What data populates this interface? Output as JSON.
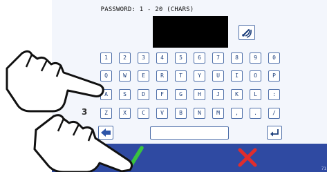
{
  "header": {
    "title": "PASSWORD: 1 - 20 (CHARS)"
  },
  "password_display": {
    "value": ""
  },
  "keyboard": {
    "rows": [
      [
        "1",
        "2",
        "3",
        "4",
        "5",
        "6",
        "7",
        "8",
        "9",
        "0"
      ],
      [
        "Q",
        "W",
        "E",
        "R",
        "T",
        "Y",
        "U",
        "I",
        "O",
        "P"
      ],
      [
        "A",
        "S",
        "D",
        "F",
        "G",
        "H",
        "J",
        "K",
        "L",
        ":"
      ],
      [
        "Z",
        "X",
        "C",
        "V",
        "B",
        "N",
        "M",
        ",",
        ".",
        "/"
      ]
    ]
  },
  "annotations": {
    "step_number": "3"
  },
  "footer": {
    "page_number": "71"
  },
  "colors": {
    "key_border": "#4d6ea8",
    "key_text": "#1d3f7c",
    "footer_bar": "#2f4aa2",
    "confirm": "#39c33f",
    "cancel": "#e02d2d"
  },
  "icons": {
    "nfc": "nfc-icon",
    "backspace": "backspace-arrow-icon",
    "enter": "enter-icon",
    "confirm": "checkmark-icon",
    "cancel": "x-mark-icon",
    "pointing_hand": "pointing-hand-icon"
  }
}
